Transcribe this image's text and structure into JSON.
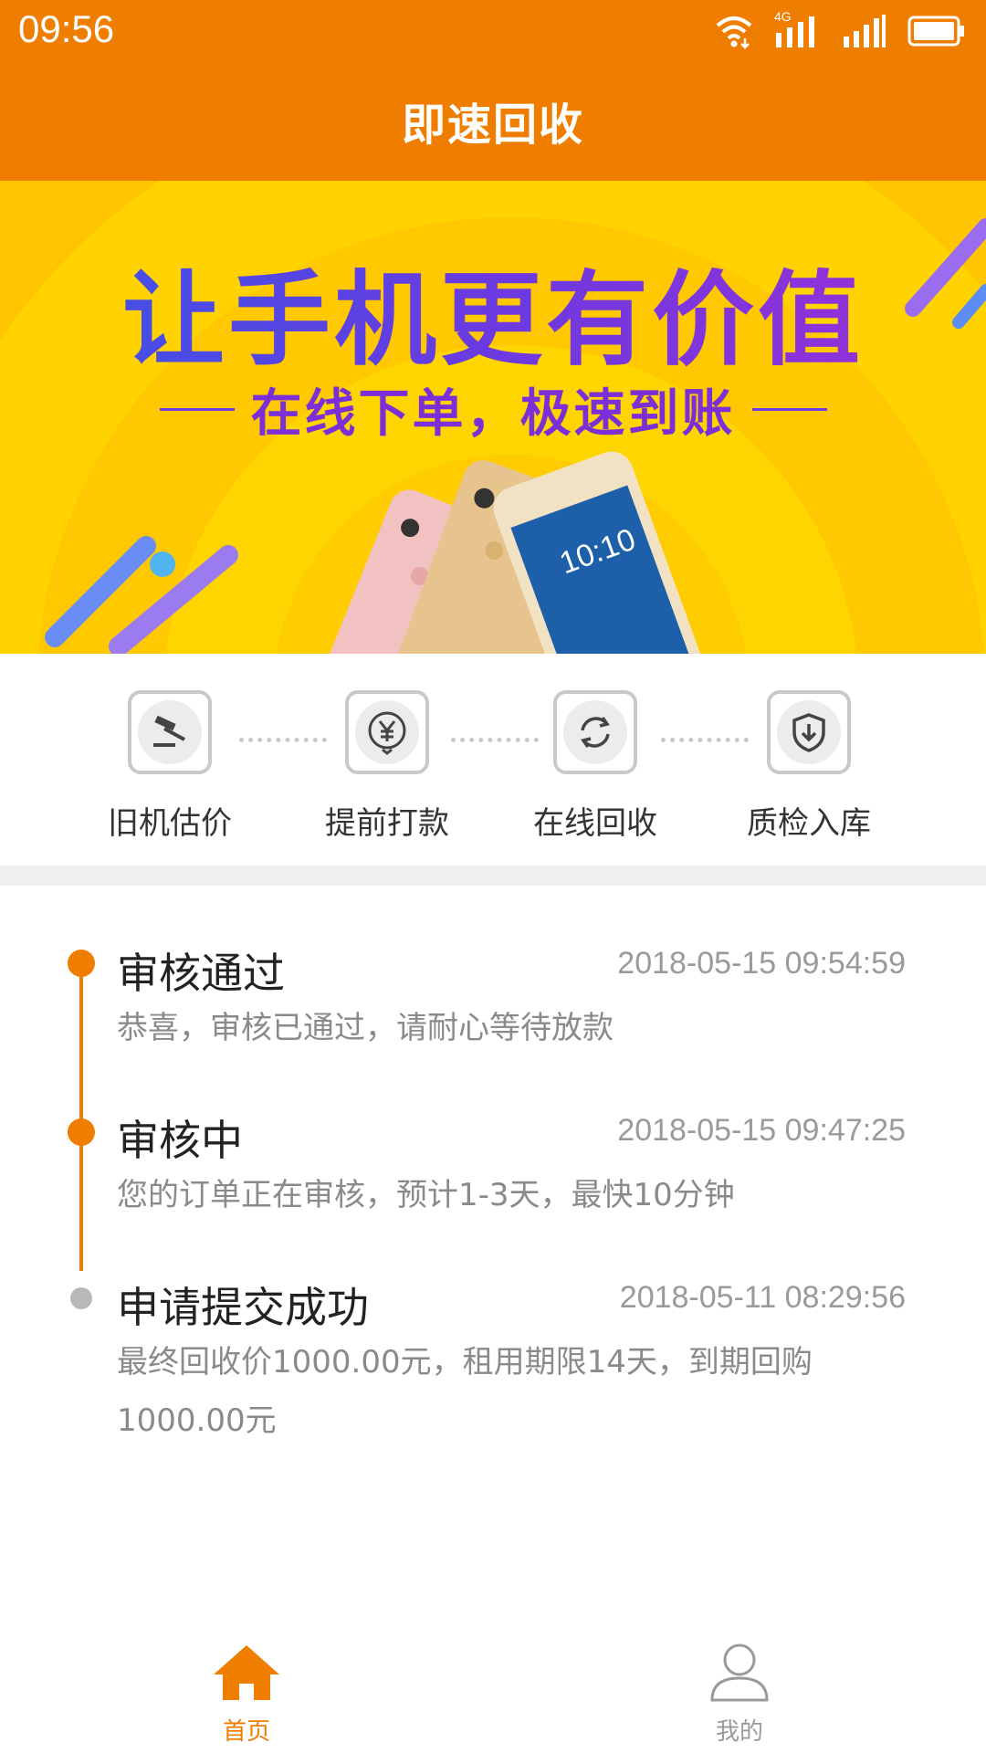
{
  "status_bar": {
    "time": "09:56",
    "network_label": "4G",
    "icons": [
      "wifi-icon",
      "signal-4g-icon",
      "signal-icon",
      "battery-icon"
    ]
  },
  "header": {
    "title": "即速回收"
  },
  "banner": {
    "title": "让手机更有价值",
    "subtitle": "在线下单，极速到账"
  },
  "steps": [
    {
      "label": "旧机估价",
      "icon": "gavel-icon"
    },
    {
      "label": "提前打款",
      "icon": "yuan-icon"
    },
    {
      "label": "在线回收",
      "icon": "refresh-icon"
    },
    {
      "label": "质检入库",
      "icon": "shield-download-icon"
    }
  ],
  "timeline": [
    {
      "title": "审核通过",
      "time": "2018-05-15 09:54:59",
      "desc": "恭喜，审核已通过，请耐心等待放款",
      "active": true
    },
    {
      "title": "审核中",
      "time": "2018-05-15 09:47:25",
      "desc": "您的订单正在审核，预计1-3天，最快10分钟",
      "active": true
    },
    {
      "title": "申请提交成功",
      "time": "2018-05-11 08:29:56",
      "desc": "最终回收价1000.00元，租用期限14天，到期回购1000.00元",
      "active": false
    }
  ],
  "tabbar": {
    "items": [
      {
        "label": "首页",
        "icon": "home-icon",
        "selected": true
      },
      {
        "label": "我的",
        "icon": "user-icon",
        "selected": false
      }
    ]
  },
  "colors": {
    "brand": "#ef7d00",
    "banner_yellow": "#ffcc00",
    "inactive_grey": "#b8b8b8"
  }
}
